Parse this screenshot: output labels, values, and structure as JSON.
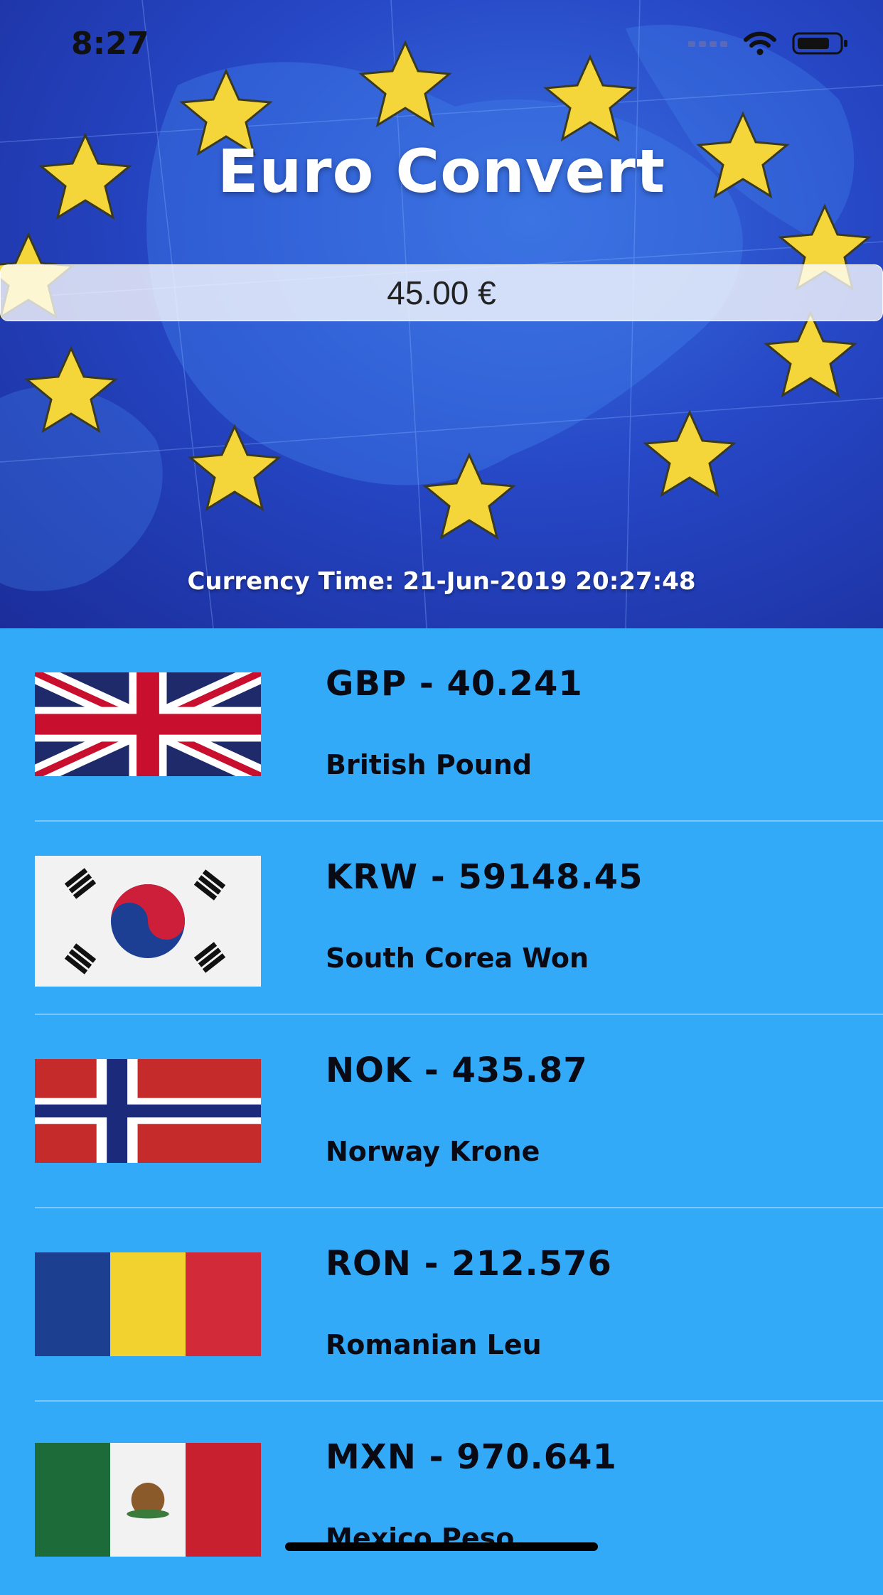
{
  "status_bar": {
    "time": "8:27",
    "icons": [
      "signal-icon",
      "wifi-icon",
      "battery-icon"
    ]
  },
  "header": {
    "title": "Euro Convert",
    "amount": "45.00 €",
    "currency_time": "Currency Time: 21-Jun-2019 20:27:48"
  },
  "currencies": [
    {
      "code_value": "GBP - 40.241",
      "name": "British Pound",
      "flag": "uk-flag"
    },
    {
      "code_value": "KRW - 59148.45",
      "name": "South Corea Won",
      "flag": "south-korea-flag"
    },
    {
      "code_value": "NOK - 435.87",
      "name": "Norway Krone",
      "flag": "norway-flag"
    },
    {
      "code_value": "RON - 212.576",
      "name": "Romanian Leu",
      "flag": "romania-flag"
    },
    {
      "code_value": "MXN - 970.641",
      "name": "Mexico Peso",
      "flag": "mexico-flag"
    }
  ],
  "colors": {
    "list_background": "#33aaf8",
    "hero_blue": "#2647c6",
    "star_yellow": "#f4d53a"
  }
}
